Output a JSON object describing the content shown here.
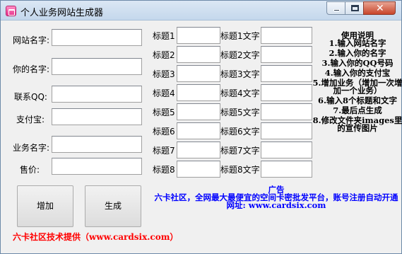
{
  "window": {
    "title": "个人业务网站生成器"
  },
  "form_left": [
    {
      "label": "网站名字:",
      "value": ""
    },
    {
      "label": "你的名字:",
      "value": ""
    },
    {
      "label": "联系QQ:",
      "value": ""
    },
    {
      "label": "支付宝:",
      "value": ""
    },
    {
      "label": "业务名字:",
      "value": ""
    },
    {
      "label": "售价:",
      "value": ""
    }
  ],
  "title_fields": [
    {
      "label": "标题1",
      "value": "",
      "text_label": "标题1文字",
      "text_value": ""
    },
    {
      "label": "标题2",
      "value": "",
      "text_label": "标题2文字",
      "text_value": ""
    },
    {
      "label": "标题3",
      "value": "",
      "text_label": "标题3文字",
      "text_value": ""
    },
    {
      "label": "标题4",
      "value": "",
      "text_label": "标题4文字",
      "text_value": ""
    },
    {
      "label": "标题5",
      "value": "",
      "text_label": "标题5文字",
      "text_value": ""
    },
    {
      "label": "标题6",
      "value": "",
      "text_label": "标题6文字",
      "text_value": ""
    },
    {
      "label": "标题7",
      "value": "",
      "text_label": "标题7文字",
      "text_value": ""
    },
    {
      "label": "标题8",
      "value": "",
      "text_label": "标题8文字",
      "text_value": ""
    }
  ],
  "help": {
    "title": "使用说明",
    "lines": [
      "1.输入网站名字",
      "2.输入你的名字",
      "3.输入你的QQ号码",
      "4.输入你的支付宝",
      "5.增加业务（增加一次增加一个业务）",
      "6.输入8个标题和文字",
      "7.最后点生成",
      "8.修改文件夹images里的宣传图片"
    ]
  },
  "buttons": {
    "add": "增加",
    "generate": "生成"
  },
  "ad": {
    "title": "广告",
    "text": "六卡社区，全网最大最便宜的空间卡密批发平台，账号注册自动开通",
    "site": "网址: www.cardsix.com"
  },
  "footer": "六卡社区技术提供（www.cardsix.com）",
  "icons": {
    "app": "app-icon",
    "minimize": "minimize-icon",
    "maximize": "maximize-icon",
    "close": "close-icon"
  },
  "colors": {
    "ad_text": "#0000ff",
    "footer_text": "#ff0000",
    "window_bg": "#f0f0f0"
  }
}
